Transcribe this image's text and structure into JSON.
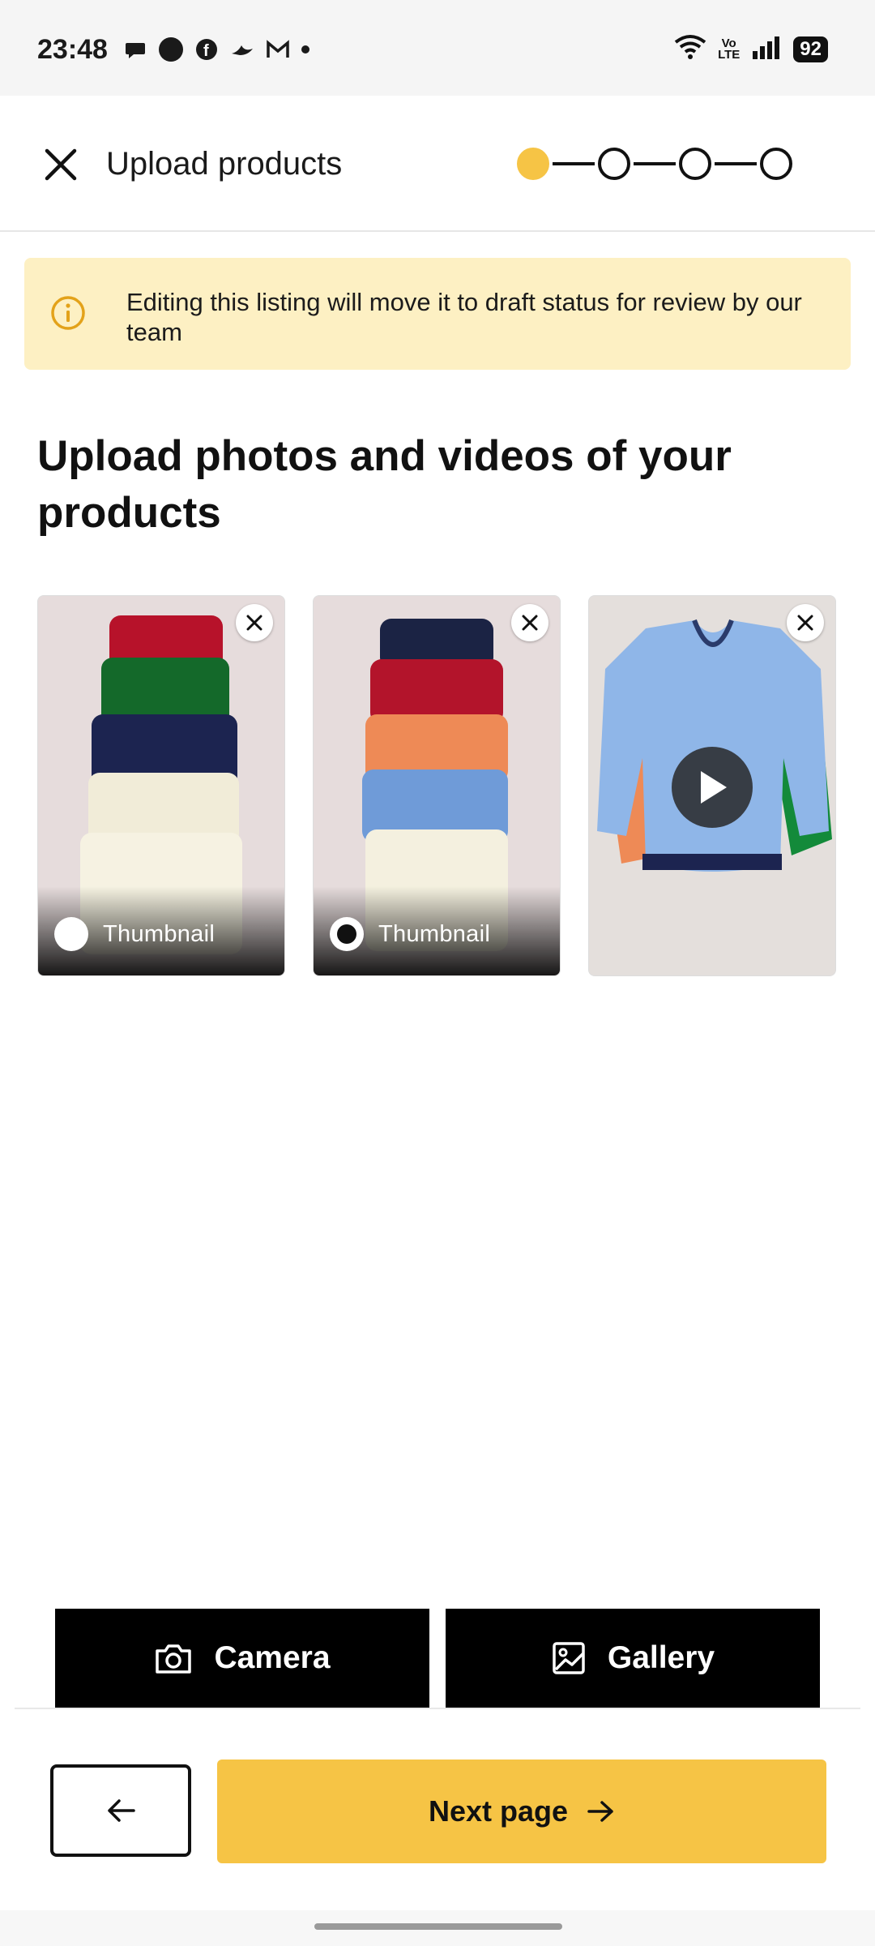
{
  "status_bar": {
    "time": "23:48",
    "notification_icons": [
      "chat-bubble-icon",
      "circle-icon",
      "facebook-icon",
      "bird-icon",
      "gmail-icon",
      "dot-icon"
    ],
    "volte": "Vo\nLTE",
    "battery": "92"
  },
  "header": {
    "title": "Upload products",
    "steps_total": 4,
    "current_step": 1
  },
  "banner": {
    "text": "Editing this listing will move it to draft status for review by our team"
  },
  "main": {
    "title": "Upload photos and videos of your products"
  },
  "media": [
    {
      "type": "photo",
      "thumbnail_label": "Thumbnail",
      "is_thumbnail": false
    },
    {
      "type": "photo",
      "thumbnail_label": "Thumbnail",
      "is_thumbnail": true
    },
    {
      "type": "video"
    }
  ],
  "actions": {
    "camera_label": "Camera",
    "gallery_label": "Gallery",
    "next_label": "Next page"
  },
  "colors": {
    "accent": "#f6c445",
    "banner_bg": "#fdf0c3",
    "banner_icon": "#e3a21a"
  }
}
